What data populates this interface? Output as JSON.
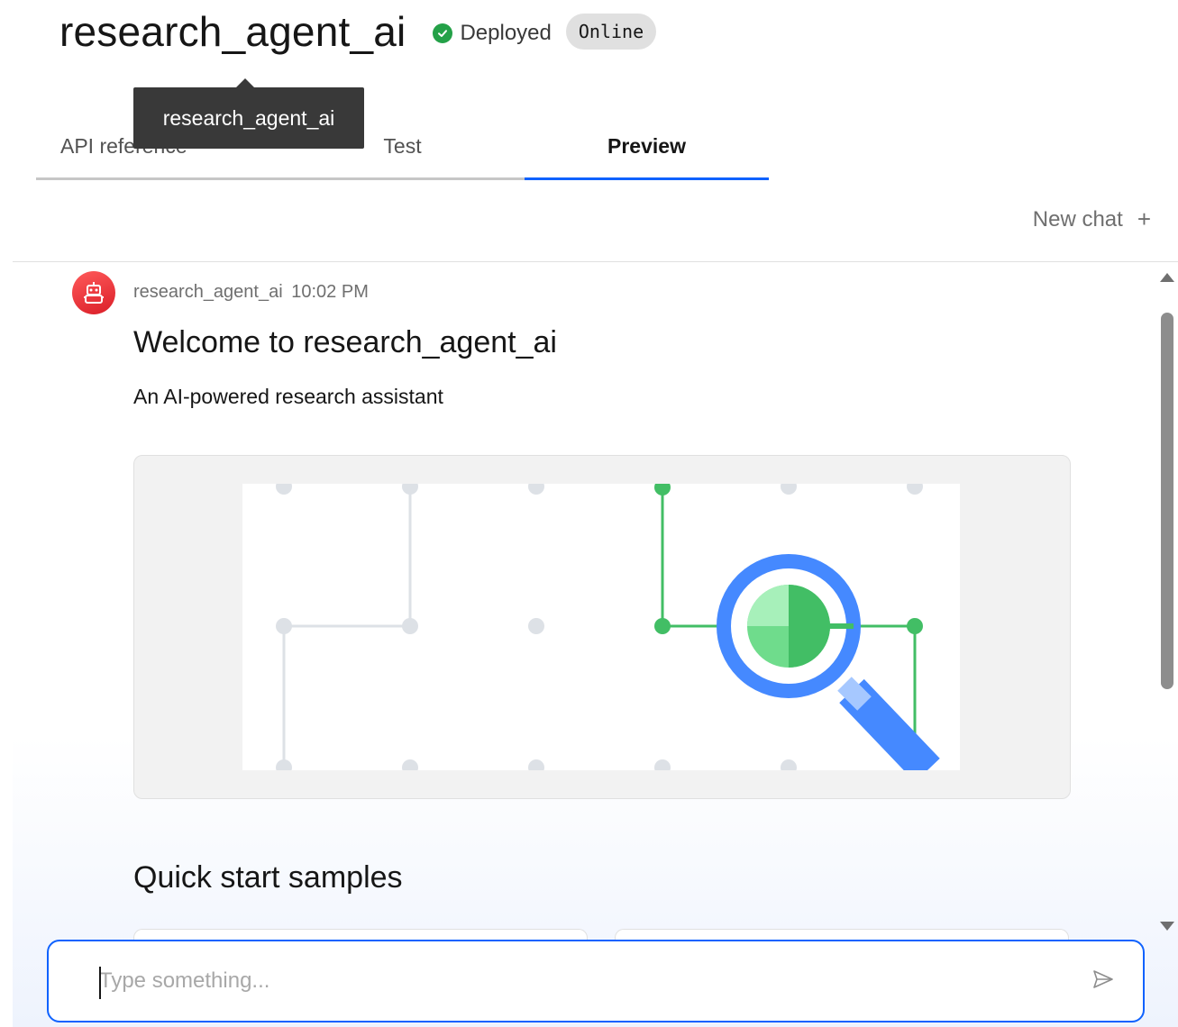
{
  "header": {
    "title": "research_agent_ai",
    "status_text": "Deployed",
    "status_icon": "check-circle-icon",
    "badge": "Online"
  },
  "tabs": [
    {
      "label": "API reference",
      "active": false
    },
    {
      "label": "Test",
      "active": false
    },
    {
      "label": "Preview",
      "active": true
    }
  ],
  "tooltip": {
    "text": "research_agent_ai"
  },
  "toolbar": {
    "new_chat_label": "New chat",
    "new_chat_icon": "plus-icon"
  },
  "message": {
    "sender": "research_agent_ai",
    "time": "10:02 PM",
    "avatar_icon": "robot-icon",
    "heading": "Welcome to research_agent_ai",
    "subtitle": "An AI-powered research assistant",
    "illustration_icon": "magnifier-icon"
  },
  "quick_start": {
    "title": "Quick start samples"
  },
  "composer": {
    "placeholder": "Type something...",
    "send_icon": "send-icon"
  },
  "colors": {
    "accent": "#0f62fe",
    "success": "#24a148",
    "avatar": "#da1e28",
    "illustration_blue": "#4589ff",
    "illustration_green": "#42be65"
  }
}
